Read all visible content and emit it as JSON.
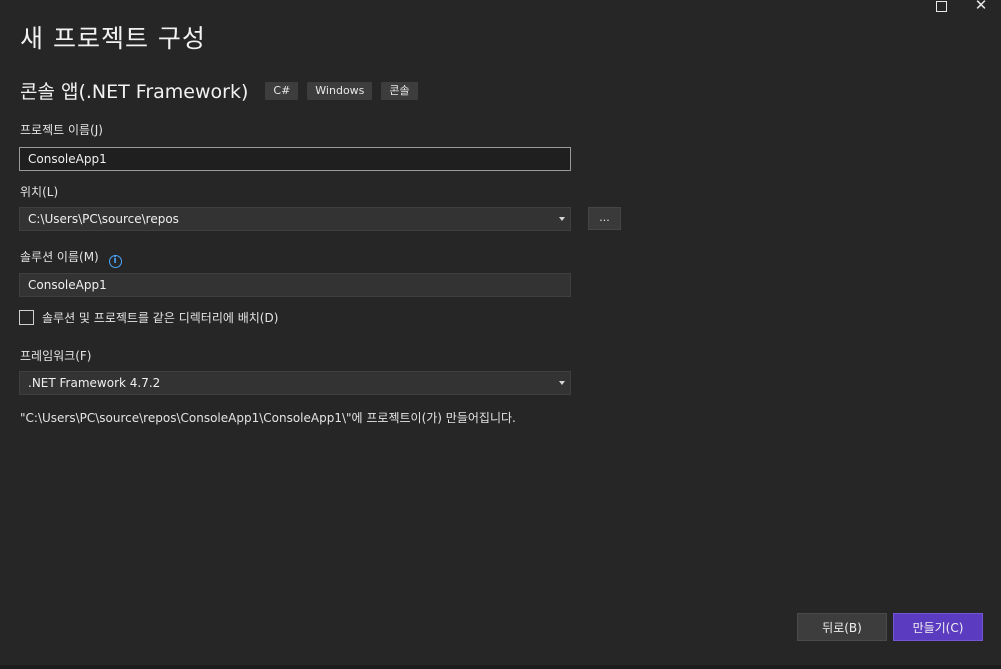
{
  "window": {
    "maximize_icon": "maximize-icon",
    "close_icon": "close-icon",
    "close_glyph": "✕"
  },
  "page": {
    "title": "새 프로젝트 구성",
    "project_type": "콘솔 앱(.NET Framework)",
    "tags": [
      "C#",
      "Windows",
      "콘솔"
    ]
  },
  "form": {
    "project_name_label": "프로젝트 이름(J)",
    "project_name_value": "ConsoleApp1",
    "location_label": "위치(L)",
    "location_value": "C:\\Users\\PC\\source\\repos",
    "browse_label": "...",
    "solution_name_label": "솔루션 이름(M)",
    "solution_name_value": "ConsoleApp1",
    "same_dir_checkbox_label": "솔루션 및 프로젝트를 같은 디렉터리에 배치(D)",
    "same_dir_checked": false,
    "framework_label": "프레임워크(F)",
    "framework_value": ".NET Framework 4.7.2",
    "info_icon_glyph": "i"
  },
  "note": {
    "path_message": "\"C:\\Users\\PC\\source\\repos\\ConsoleApp1\\ConsoleApp1\\\"에 프로젝트이(가) 만들어집니다."
  },
  "buttons": {
    "back": "뒤로(B)",
    "create": "만들기(C)"
  },
  "colors": {
    "background": "#262626",
    "accent": "#5b3bbf",
    "info": "#4ea5ff"
  }
}
